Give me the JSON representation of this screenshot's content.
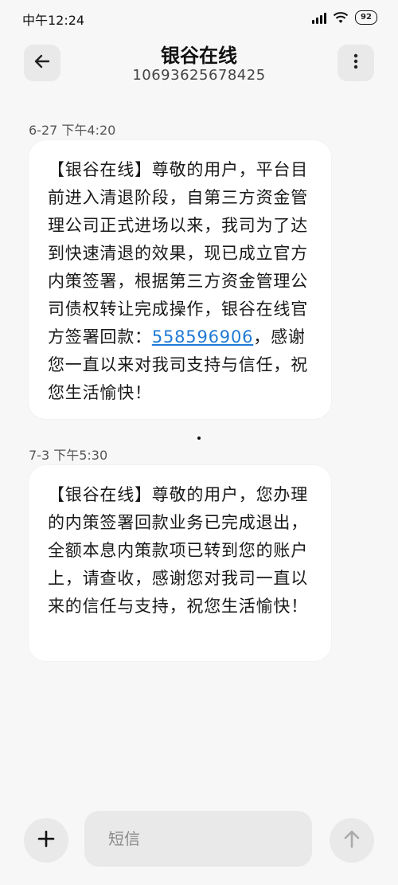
{
  "status_bar": {
    "time": "中午12:24",
    "battery": "92"
  },
  "header": {
    "contact_name": "银谷在线",
    "contact_number": "10693625678425"
  },
  "messages": [
    {
      "time": "6-27 下午4:20",
      "text_before_link": "【银谷在线】尊敬的用户，平台目前进入清退阶段，自第三方资金管理公司正式进场以来，我司为了达到快速清退的效果，现已成立官方内策签署，根据第三方资金管理公司债权转让完成操作，银谷在线官方签署回款：",
      "link": "558596906",
      "text_after_link": "，感谢您一直以来对我司支持与信任，祝您生活愉快！"
    },
    {
      "time": "7-3 下午5:30",
      "text": "【银谷在线】尊敬的用户，您办理的内策签署回款业务已完成退出，全额本息内策款项已转到您的账户上，请查收，感谢您对我司一直以来的信任与支持，祝您生活愉快！"
    }
  ],
  "composer": {
    "placeholder": "短信"
  },
  "icons": {
    "back": "back-arrow-icon",
    "more": "more-vertical-icon",
    "add": "plus-icon",
    "send": "send-arrow-icon"
  },
  "colors": {
    "link": "#1f7ad6",
    "bubble": "#ffffff",
    "background": "#f7f7f7"
  }
}
